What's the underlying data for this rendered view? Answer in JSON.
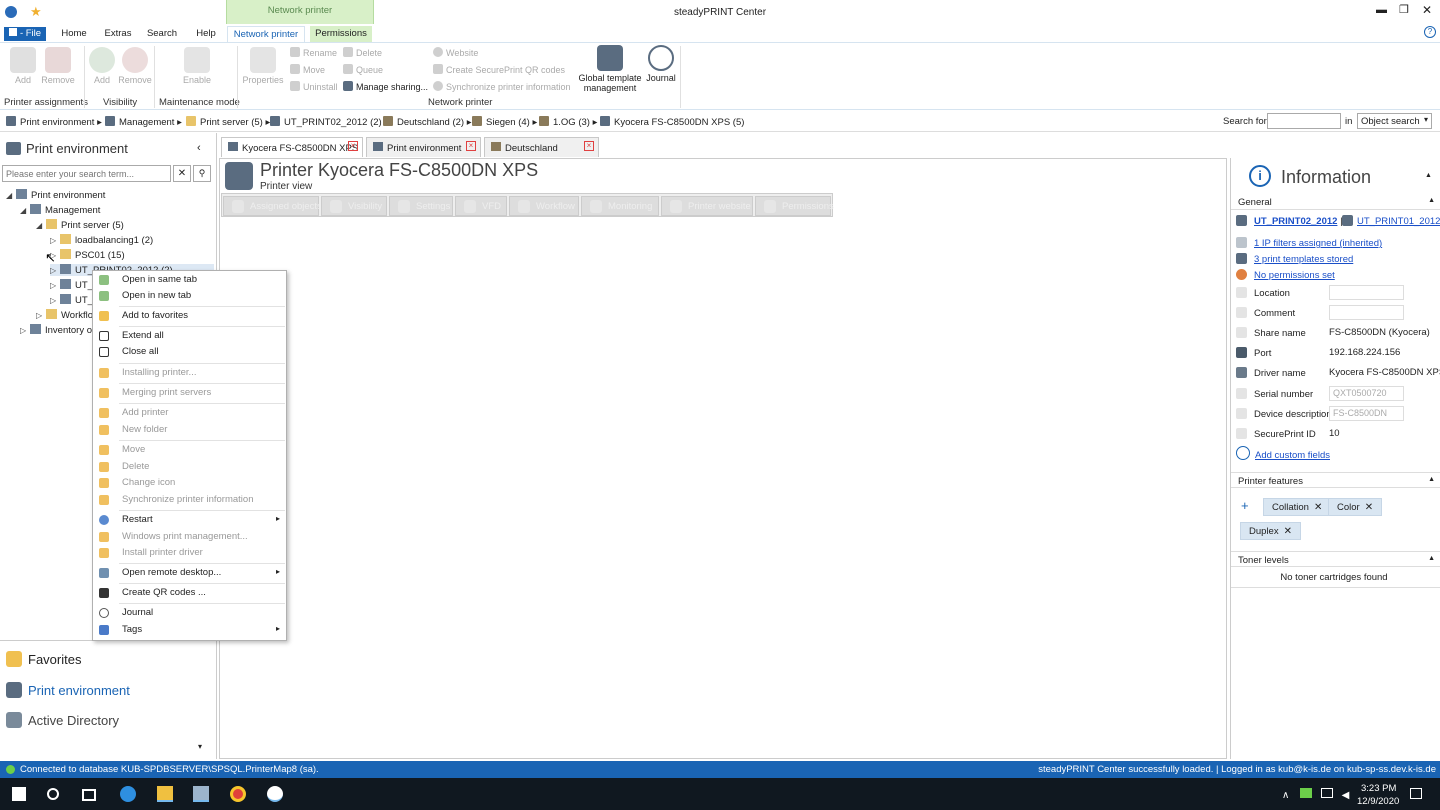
{
  "window": {
    "title": "steadyPRINT Center"
  },
  "menu": {
    "file": "File",
    "home": "Home",
    "extras": "Extras",
    "search": "Search",
    "help": "Help",
    "contextual_group": "Network printer",
    "network_printer": "Network printer",
    "permissions": "Permissions"
  },
  "ribbon": {
    "printer_assignments": {
      "add": "Add",
      "remove": "Remove",
      "label": "Printer assignments"
    },
    "visibility": {
      "add": "Add",
      "remove": "Remove",
      "label": "Visibility"
    },
    "maintenance": {
      "enable": "Enable",
      "label": "Maintenance mode"
    },
    "network_printer": {
      "properties": "Properties",
      "rename": "Rename",
      "move": "Move",
      "uninstall": "Uninstall",
      "delete": "Delete",
      "queue": "Queue",
      "manage_sharing": "Manage sharing...",
      "website": "Website",
      "create_qr": "Create SecurePrint QR codes",
      "sync_info": "Synchronize printer information",
      "global_template": "Global template management",
      "journal": "Journal",
      "label": "Network printer"
    }
  },
  "breadcrumb": [
    "Print environment",
    "Management",
    "Print server (5)",
    "UT_PRINT02_2012 (2)",
    "Deutschland (2)",
    "Siegen (4)",
    "1.OG (3)",
    "Kyocera FS-C8500DN XPS (5)"
  ],
  "search": {
    "label": "Search for",
    "value": "",
    "in_label": "in",
    "scope": "Object search"
  },
  "left": {
    "title": "Print environment",
    "search_placeholder": "Please enter your search term...",
    "tree": [
      {
        "label": "Print environment"
      },
      {
        "label": "Management"
      },
      {
        "label": "Print server (5)"
      },
      {
        "label": "loadbalancing1 (2)"
      },
      {
        "label": "PSC01 (15)"
      },
      {
        "label": "UT_PRINT02_2012 (2)"
      },
      {
        "label": "UT_I"
      },
      {
        "label": "UT_I"
      },
      {
        "label": "Workflo"
      },
      {
        "label": "Inventory of"
      }
    ],
    "nav": {
      "favorites": "Favorites",
      "print_env": "Print environment",
      "active_directory": "Active Directory"
    }
  },
  "context_menu": [
    {
      "label": "Open in same tab",
      "disabled": false
    },
    {
      "label": "Open in new tab",
      "disabled": false
    },
    {
      "label": "Add to favorites",
      "disabled": false
    },
    {
      "label": "Extend all",
      "disabled": false
    },
    {
      "label": "Close all",
      "disabled": false
    },
    {
      "label": "Installing printer...",
      "disabled": true
    },
    {
      "label": "Merging print servers",
      "disabled": true
    },
    {
      "label": "Add printer",
      "disabled": true
    },
    {
      "label": "New folder",
      "disabled": true
    },
    {
      "label": "Move",
      "disabled": true
    },
    {
      "label": "Delete",
      "disabled": true
    },
    {
      "label": "Change icon",
      "disabled": true
    },
    {
      "label": "Synchronize printer information",
      "disabled": true
    },
    {
      "label": "Restart",
      "disabled": false
    },
    {
      "label": "Windows print management...",
      "disabled": true
    },
    {
      "label": "Install printer driver",
      "disabled": true
    },
    {
      "label": "Open remote desktop...",
      "disabled": false
    },
    {
      "label": "Create QR codes ...",
      "disabled": false
    },
    {
      "label": "Journal",
      "disabled": false
    },
    {
      "label": "Tags",
      "disabled": false
    }
  ],
  "doc_tabs": [
    "Kyocera FS-C8500DN XPS",
    "Print environment",
    "Deutschland"
  ],
  "printer": {
    "title": "Printer Kyocera FS-C8500DN XPS",
    "subtitle": "Printer view"
  },
  "sub_tabs": [
    "Assigned objects",
    "Visibility",
    "Settings",
    "VFD",
    "Workflow",
    "Monitoring",
    "Printer website",
    "Permissions"
  ],
  "info": {
    "title": "Information",
    "general": "General",
    "servers": [
      "UT_PRINT02_2012",
      "UT_PRINT01_2012"
    ],
    "separator": "|",
    "ip_filters": "1 IP filters assigned (inherited)",
    "templates": "3 print templates stored",
    "permissions": "No permissions set",
    "fields": {
      "location": "Location",
      "comment": "Comment",
      "share_name": "Share name",
      "share_value": "FS-C8500DN (Kyocera)",
      "port": "Port",
      "port_value": "192.168.224.156",
      "driver": "Driver name",
      "driver_value": "Kyocera FS-C8500DN XPS",
      "serial": "Serial number",
      "serial_value": "QXT0500720",
      "device_desc": "Device description",
      "device_value": "FS-C8500DN",
      "secureprint": "SecurePrint ID",
      "secureprint_value": "10"
    },
    "custom_fields": "Add custom fields",
    "features_title": "Printer features",
    "features": [
      "Collation",
      "Color",
      "Duplex"
    ],
    "toner_title": "Toner levels",
    "toner_empty": "No toner cartridges found"
  },
  "status": {
    "left": "Connected to database KUB-SPDBSERVER\\SPSQL.PrinterMap8 (sa).",
    "right": "steadyPRINT Center successfully loaded. | Logged in as kub@k-is.de on kub-sp-ss.dev.k-is.de"
  },
  "taskbar": {
    "time": "3:23 PM",
    "date": "12/9/2020"
  }
}
